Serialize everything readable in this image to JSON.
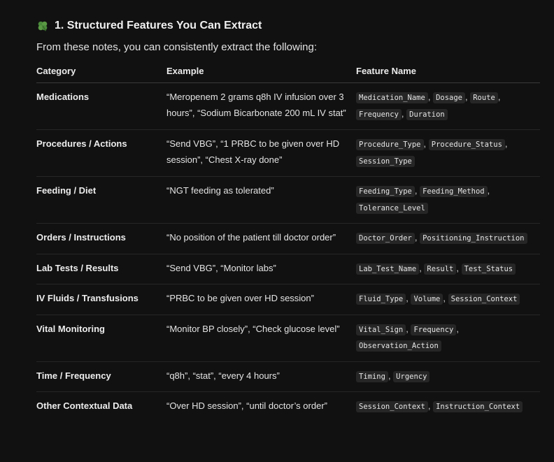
{
  "section": {
    "icon": "four-leaf-clover-icon",
    "title": "1. Structured Features You Can Extract",
    "intro": "From these notes, you can consistently extract the following:"
  },
  "table": {
    "headers": [
      "Category",
      "Example",
      "Feature Name"
    ],
    "rows": [
      {
        "category": "Medications",
        "example": "“Meropenem 2 grams q8h IV infusion over 3 hours”, “Sodium Bicarbonate 200 mL IV stat”",
        "features": [
          "Medication_Name",
          "Dosage",
          "Route",
          "Frequency",
          "Duration"
        ]
      },
      {
        "category": "Procedures / Actions",
        "example": "“Send VBG”, “1 PRBC to be given over HD session”, “Chest X-ray done”",
        "features": [
          "Procedure_Type",
          "Procedure_Status",
          "Session_Type"
        ]
      },
      {
        "category": "Feeding / Diet",
        "example": "“NGT feeding as tolerated”",
        "features": [
          "Feeding_Type",
          "Feeding_Method",
          "Tolerance_Level"
        ]
      },
      {
        "category": "Orders / Instructions",
        "example": "“No position of the patient till doctor order”",
        "features": [
          "Doctor_Order",
          "Positioning_Instruction"
        ]
      },
      {
        "category": "Lab Tests / Results",
        "example": "“Send VBG”, “Monitor labs”",
        "features": [
          "Lab_Test_Name",
          "Result",
          "Test_Status"
        ]
      },
      {
        "category": "IV Fluids / Transfusions",
        "example": "“PRBC to be given over HD session”",
        "features": [
          "Fluid_Type",
          "Volume",
          "Session_Context"
        ]
      },
      {
        "category": "Vital Monitoring",
        "example": "“Monitor BP closely”, “Check glucose level”",
        "features": [
          "Vital_Sign",
          "Frequency",
          "Observation_Action"
        ]
      },
      {
        "category": "Time / Frequency",
        "example": "“q8h”, “stat”, “every 4 hours”",
        "features": [
          "Timing",
          "Urgency"
        ]
      },
      {
        "category": "Other Contextual Data",
        "example": "“Over HD session”, “until doctor’s order”",
        "features": [
          "Session_Context",
          "Instruction_Context"
        ]
      }
    ]
  },
  "colors": {
    "background": "#111111",
    "code_bg": "#262626",
    "clover": "#4a8a3a"
  }
}
